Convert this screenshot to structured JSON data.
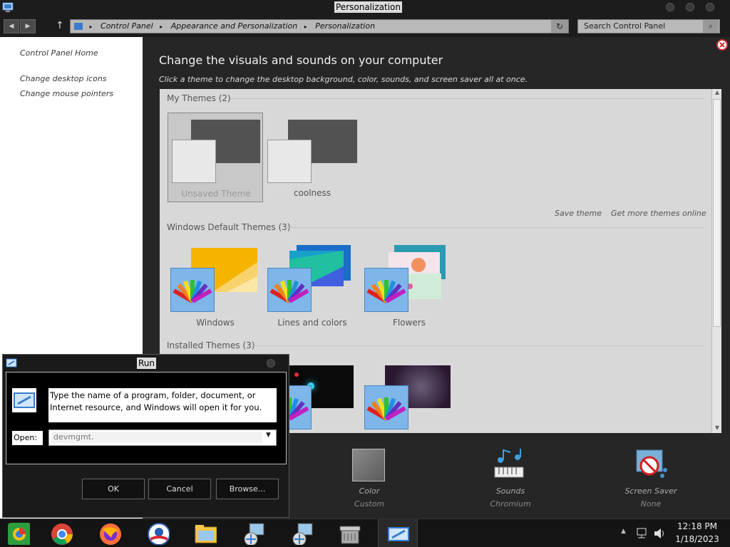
{
  "window": {
    "title": "Personalization"
  },
  "address": {
    "crumbs": [
      "Control Panel",
      "Appearance and Personalization",
      "Personalization"
    ],
    "search_placeholder": "Search Control Panel"
  },
  "sidebar": {
    "home": "Control Panel Home",
    "links": [
      "Change desktop icons",
      "Change mouse pointers"
    ]
  },
  "main": {
    "heading": "Change the visuals and sounds on your computer",
    "subheading": "Click a theme to change the desktop background, color, sounds, and screen saver all at once.",
    "my_themes": {
      "title": "My Themes (2)",
      "items": [
        "Unsaved Theme",
        "coolness"
      ]
    },
    "save_theme": "Save theme",
    "get_more": "Get more themes online",
    "default_themes": {
      "title": "Windows Default Themes (3)",
      "items": [
        "Windows",
        "Lines and colors",
        "Flowers"
      ]
    },
    "installed_themes": {
      "title": "Installed Themes (3)"
    }
  },
  "bottom": {
    "color": {
      "label": "Color",
      "value": "Custom"
    },
    "sounds": {
      "label": "Sounds",
      "value": "Chromium"
    },
    "screensaver": {
      "label": "Screen Saver",
      "value": "None"
    }
  },
  "run_dialog": {
    "title": "Run",
    "description": "Type the name of a program, folder, document, or Internet resource, and Windows will open it for you.",
    "open_label": "Open:",
    "open_value": "devmgmt.",
    "ok": "OK",
    "cancel": "Cancel",
    "browse": "Browse..."
  },
  "taskbar": {
    "time": "12:18 PM",
    "date": "1/18/2023",
    "icons": [
      "chrome-color-icon",
      "chrome-icon",
      "firefox-icon",
      "obama-logo-icon",
      "file-explorer-icon",
      "network-setup-icon",
      "network-setup-icon",
      "cash-register-icon",
      "run-icon"
    ]
  }
}
